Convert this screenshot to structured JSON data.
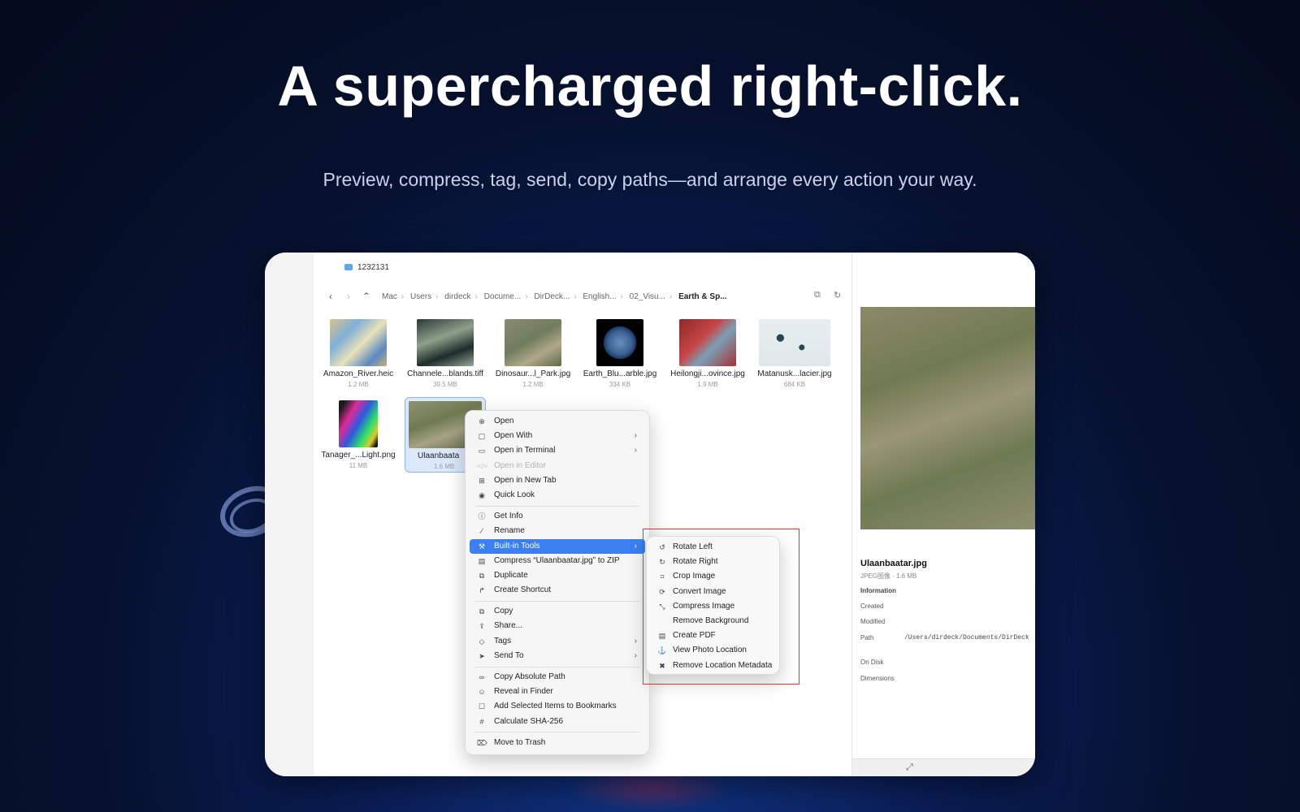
{
  "hero": {
    "title": "A supercharged right-click.",
    "subtitle": "Preview, compress, tag, send, copy paths—and arrange every action your way."
  },
  "tab": {
    "label": "1232131"
  },
  "toolbar": {
    "back_icon": "chevron-left-icon",
    "forward_icon": "chevron-right-icon",
    "up_icon": "chevron-up-icon",
    "breadcrumbs": [
      "Mac",
      "Users",
      "dirdeck",
      "Docume...",
      "DirDeck...",
      "English...",
      "02_Visu...",
      "Earth & Sp..."
    ],
    "right_icons": [
      "copy-icon",
      "refresh-icon"
    ]
  },
  "files": [
    {
      "name": "Amazon_River.heic",
      "size": "1.2 MB"
    },
    {
      "name": "Channele...blands.tiff",
      "size": "39.5 MB"
    },
    {
      "name": "Dinosaur...l_Park.jpg",
      "size": "1.2 MB"
    },
    {
      "name": "Earth_Blu...arble.jpg",
      "size": "334 KB"
    },
    {
      "name": "Heilongji...ovince.jpg",
      "size": "1.9 MB"
    },
    {
      "name": "Matanusk...lacier.jpg",
      "size": "684 KB"
    },
    {
      "name": "Tanager_...Light.png",
      "size": "11 MB"
    },
    {
      "name": "Ulaanbaata",
      "size": "1.6 MB"
    }
  ],
  "context_menu": {
    "items": [
      {
        "label": "Open",
        "icon": "open-icon"
      },
      {
        "label": "Open With",
        "icon": "open-with-icon",
        "submenu": true
      },
      {
        "label": "Open in Terminal",
        "icon": "terminal-icon",
        "submenu": true
      },
      {
        "label": "Open in Editor",
        "icon": "code-icon",
        "disabled": true
      },
      {
        "label": "Open in New Tab",
        "icon": "new-tab-icon"
      },
      {
        "label": "Quick Look",
        "icon": "eye-icon"
      },
      {
        "label": "Get Info",
        "icon": "info-icon"
      },
      {
        "label": "Rename",
        "icon": "pencil-icon"
      },
      {
        "label": "Built-in Tools",
        "icon": "tools-icon",
        "submenu": true,
        "active": true
      },
      {
        "label": "Compress “Ulaanbaatar.jpg” to ZIP",
        "icon": "archive-icon"
      },
      {
        "label": "Duplicate",
        "icon": "duplicate-icon"
      },
      {
        "label": "Create Shortcut",
        "icon": "shortcut-icon"
      },
      {
        "label": "Copy",
        "icon": "copy-icon"
      },
      {
        "label": "Share...",
        "icon": "share-icon"
      },
      {
        "label": "Tags",
        "icon": "tag-icon",
        "submenu": true
      },
      {
        "label": "Send To",
        "icon": "send-icon",
        "submenu": true
      },
      {
        "label": "Copy Absolute Path",
        "icon": "link-icon"
      },
      {
        "label": "Reveal in Finder",
        "icon": "finder-icon"
      },
      {
        "label": "Add Selected Items to Bookmarks",
        "icon": "bookmark-icon"
      },
      {
        "label": "Calculate SHA-256",
        "icon": "hash-icon"
      },
      {
        "label": "Move to Trash",
        "icon": "trash-icon"
      }
    ]
  },
  "submenu": {
    "items": [
      {
        "label": "Rotate Left",
        "icon": "rotate-left-icon"
      },
      {
        "label": "Rotate Right",
        "icon": "rotate-right-icon"
      },
      {
        "label": "Crop Image",
        "icon": "crop-icon"
      },
      {
        "label": "Convert Image",
        "icon": "convert-icon"
      },
      {
        "label": "Compress Image",
        "icon": "compress-icon"
      },
      {
        "label": "Remove Background",
        "icon": ""
      },
      {
        "label": "Create PDF",
        "icon": "pdf-icon"
      },
      {
        "label": "View Photo Location",
        "icon": "location-icon"
      },
      {
        "label": "Remove Location Metadata",
        "icon": "remove-location-icon"
      }
    ]
  },
  "preview": {
    "filename": "Ulaanbaatar.jpg",
    "meta": "JPEG图像 · 1.6 MB",
    "section": "Information",
    "created_label": "Created",
    "modified_label": "Modified",
    "path_label": "Path",
    "path_value": "/Users/dirdeck/Documents/DirDeck",
    "on_disk_label": "On Disk",
    "dimensions_label": "Dimensions"
  },
  "colors": {
    "accent": "#3b7ff0",
    "highlight_box": "#e0332e",
    "background": "#06112e"
  }
}
